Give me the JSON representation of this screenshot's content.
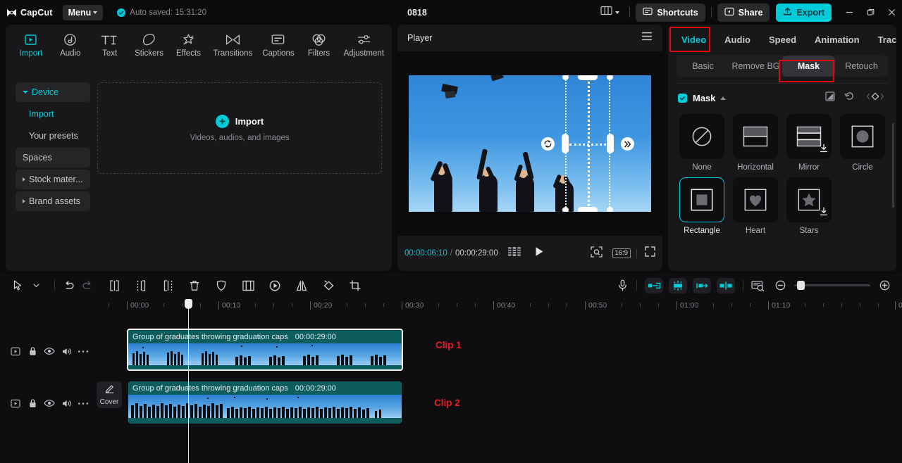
{
  "titlebar": {
    "brand": "CapCut",
    "menu_label": "Menu",
    "autosave_text": "Auto saved: 15:31:20",
    "project_title": "0818",
    "shortcuts_label": "Shortcuts",
    "share_label": "Share",
    "export_label": "Export",
    "icons": {
      "layout": "layout-icon",
      "layout_caret": "chevron-down-icon",
      "minimize": "minimize-icon",
      "maximize": "restore-icon",
      "close": "close-icon"
    }
  },
  "left_panel": {
    "tabs": [
      {
        "label": "Import",
        "icon": "import-icon",
        "active": true
      },
      {
        "label": "Audio",
        "icon": "audio-icon",
        "active": false
      },
      {
        "label": "Text",
        "icon": "text-icon",
        "active": false
      },
      {
        "label": "Stickers",
        "icon": "stickers-icon",
        "active": false
      },
      {
        "label": "Effects",
        "icon": "effects-icon",
        "active": false
      },
      {
        "label": "Transitions",
        "icon": "transitions-icon",
        "active": false
      },
      {
        "label": "Captions",
        "icon": "captions-icon",
        "active": false
      },
      {
        "label": "Filters",
        "icon": "filters-icon",
        "active": false
      },
      {
        "label": "Adjustment",
        "icon": "adjustment-icon",
        "active": false
      }
    ],
    "sidebar": [
      {
        "label": "Device",
        "expandable": true,
        "expanded": true,
        "teal": true,
        "boxed": true
      },
      {
        "label": "Import",
        "sub": true,
        "teal": true
      },
      {
        "label": "Your presets",
        "sub": true
      },
      {
        "label": "Spaces",
        "boxed": true
      },
      {
        "label": "Stock mater...",
        "expandable": true,
        "boxed": true
      },
      {
        "label": "Brand assets",
        "expandable": true,
        "boxed": true
      }
    ],
    "dropzone": {
      "title": "Import",
      "subtitle": "Videos, audios, and images",
      "plus_icon": "plus-icon"
    }
  },
  "player": {
    "title": "Player",
    "menu_icon": "hamburger-icon",
    "current_time": "00:00:06:10",
    "time_separator": "/",
    "total_time": "00:00:29:00",
    "frame_icon": "frames-icon",
    "play_icon": "play-icon",
    "crop_icon": "crop-preview-icon",
    "ratio_label": "16:9",
    "fullscreen_icon": "fullscreen-icon",
    "overlay": {
      "rotate_icon": "rotate-handle-icon",
      "feather_icon": "feather-handle-icon"
    }
  },
  "right_panel": {
    "tabs": [
      {
        "label": "Video",
        "active": true,
        "annotated": true
      },
      {
        "label": "Audio",
        "active": false
      },
      {
        "label": "Speed",
        "active": false
      },
      {
        "label": "Animation",
        "active": false
      },
      {
        "label": "Tracki",
        "active": false,
        "clipped": true
      }
    ],
    "segments": [
      {
        "label": "Basic",
        "active": false
      },
      {
        "label": "Remove BG",
        "active": false
      },
      {
        "label": "Mask",
        "active": true,
        "annotated": true
      },
      {
        "label": "Retouch",
        "active": false
      }
    ],
    "mask_section": {
      "title": "Mask",
      "enabled": true,
      "collapse_icon": "caret-up-icon",
      "invert_icon": "invert-mask-icon",
      "reset_icon": "reset-icon",
      "keyframe_icon": "keyframe-diamond-icon"
    },
    "mask_options": [
      {
        "label": "None",
        "icon": "none-mask-icon",
        "selected": false,
        "download": false
      },
      {
        "label": "Horizontal",
        "icon": "horizontal-mask-icon",
        "selected": false,
        "download": false
      },
      {
        "label": "Mirror",
        "icon": "mirror-mask-icon",
        "selected": false,
        "download": true
      },
      {
        "label": "Circle",
        "icon": "circle-mask-icon",
        "selected": false,
        "download": false
      },
      {
        "label": "Rectangle",
        "icon": "rectangle-mask-icon",
        "selected": true,
        "download": false
      },
      {
        "label": "Heart",
        "icon": "heart-mask-icon",
        "selected": false,
        "download": false
      },
      {
        "label": "Stars",
        "icon": "stars-mask-icon",
        "selected": false,
        "download": true
      }
    ]
  },
  "timeline": {
    "toolbar_left": [
      {
        "icon": "select-cursor-icon",
        "name": "select-tool"
      },
      {
        "icon": "chevron-down-icon",
        "name": "select-tool-dropdown"
      },
      {
        "icon": "undo-icon",
        "name": "undo-button"
      },
      {
        "icon": "redo-icon",
        "name": "redo-button",
        "disabled": true
      },
      {
        "icon": "split-icon",
        "name": "split-button"
      },
      {
        "icon": "trim-left-icon",
        "name": "trim-left-button"
      },
      {
        "icon": "trim-right-icon",
        "name": "trim-right-button"
      },
      {
        "icon": "delete-icon",
        "name": "delete-button"
      },
      {
        "icon": "shield-icon",
        "name": "stabilize-button"
      },
      {
        "icon": "freeze-icon",
        "name": "freeze-button"
      },
      {
        "icon": "speed-icon",
        "name": "speed-button"
      },
      {
        "icon": "mirror-icon",
        "name": "mirror-button"
      },
      {
        "icon": "rotate-icon",
        "name": "rotate-button"
      },
      {
        "icon": "crop-icon",
        "name": "crop-button"
      }
    ],
    "toolbar_right": [
      {
        "icon": "microphone-icon",
        "name": "record-voiceover-button"
      },
      {
        "icon": "clip-in-icon",
        "name": "clip-in-button"
      },
      {
        "icon": "auto-cut-icon",
        "name": "auto-cut-button"
      },
      {
        "icon": "clip-out-icon",
        "name": "clip-out-button"
      },
      {
        "icon": "split-clip-icon",
        "name": "split-clip-button"
      },
      {
        "icon": "preview-icon",
        "name": "preview-button"
      },
      {
        "icon": "zoom-out-icon",
        "name": "zoom-out-button"
      },
      {
        "icon": "zoom-in-icon",
        "name": "zoom-in-button"
      }
    ],
    "ruler_labels": [
      "00:00",
      "00:10",
      "00:20",
      "00:30",
      "00:40",
      "00:50",
      "01:00",
      "01:10",
      "0"
    ],
    "cover_label": "Cover",
    "track_controls": [
      {
        "icon": "video-track-icon",
        "name": "track-type-icon"
      },
      {
        "icon": "lock-icon",
        "name": "lock-track-button"
      },
      {
        "icon": "eye-icon",
        "name": "hide-track-button"
      },
      {
        "icon": "speaker-icon",
        "name": "mute-track-button"
      },
      {
        "icon": "more-icon",
        "name": "track-more-button"
      }
    ],
    "clips": [
      {
        "name": "Group of graduates throwing graduation caps",
        "duration": "00:00:29:00",
        "selected": true
      },
      {
        "name": "Group of graduates throwing graduation caps",
        "duration": "00:00:29:00",
        "selected": false
      }
    ],
    "annotations": [
      {
        "text": "Clip 1"
      },
      {
        "text": "Clip 2"
      }
    ]
  }
}
